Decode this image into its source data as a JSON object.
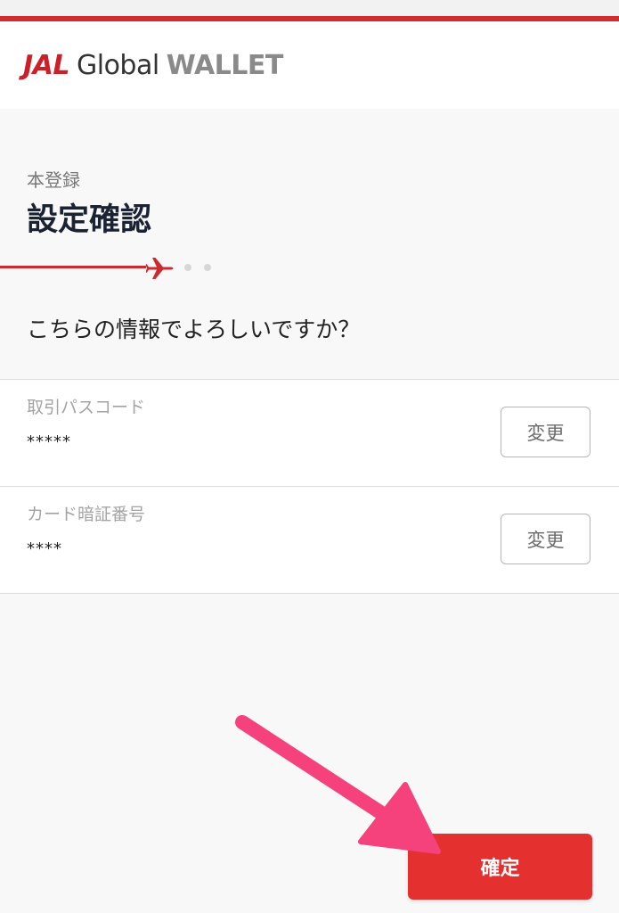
{
  "header": {
    "logo_jal": "JAL",
    "logo_global": "Global",
    "logo_wallet": "WALLET",
    "brand_color": "#cc1f27"
  },
  "page": {
    "step_label": "本登録",
    "title": "設定確認",
    "question": "こちらの情報でよろしいですか？"
  },
  "progress": {
    "icon": "airplane-icon",
    "current_step": 1,
    "total_steps": 3
  },
  "rows": [
    {
      "label": "取引パスコード",
      "value": "*****",
      "button": "変更"
    },
    {
      "label": "カード暗証番号",
      "value": "****",
      "button": "変更"
    }
  ],
  "confirm": {
    "label": "確定",
    "color": "#e4302f"
  },
  "annotation": {
    "icon": "pink-arrow-icon",
    "color": "#f5417c"
  }
}
